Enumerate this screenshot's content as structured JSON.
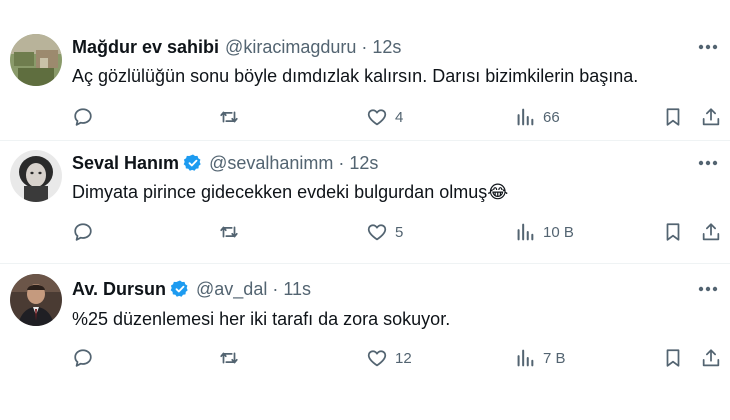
{
  "tweets": [
    {
      "name": "Mağdur ev sahibi",
      "verified": false,
      "handle": "@kiracimagduru",
      "dot": "·",
      "time": "12s",
      "text": "Aç gözlülüğün sonu böyle dımdızlak kalırsın. Darısı bizimkilerin başına.",
      "replies": "",
      "retweets": "",
      "likes": "4",
      "views": "66"
    },
    {
      "name": "Seval Hanım",
      "verified": true,
      "handle": "@sevalhanimm",
      "dot": "·",
      "time": "12s",
      "text": "Dimyata pirince gidecekken evdeki bulgurdan olmuş😂",
      "replies": "",
      "retweets": "",
      "likes": "5",
      "views": "10 B"
    },
    {
      "name": "Av. Dursun",
      "verified": true,
      "handle": "@av_dal",
      "dot": "·",
      "time": "11s",
      "text": "%25 düzenlemesi her iki tarafı da zora sokuyor.",
      "replies": "",
      "retweets": "",
      "likes": "12",
      "views": "7 B"
    }
  ],
  "colors": {
    "text": "#0f1419",
    "muted": "#536471",
    "verified": "#1d9bf0",
    "divider": "#eff3f4"
  },
  "icons": [
    "reply-icon",
    "retweet-icon",
    "like-icon",
    "views-icon",
    "bookmark-icon",
    "share-icon",
    "more-icon",
    "verified-icon"
  ]
}
